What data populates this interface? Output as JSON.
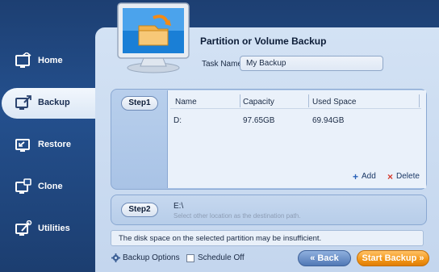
{
  "sidebar": {
    "items": [
      {
        "label": "Home",
        "icon": "home-icon"
      },
      {
        "label": "Backup",
        "icon": "backup-icon",
        "active": true
      },
      {
        "label": "Restore",
        "icon": "restore-icon"
      },
      {
        "label": "Clone",
        "icon": "clone-icon"
      },
      {
        "label": "Utilities",
        "icon": "utilities-icon"
      }
    ]
  },
  "header": {
    "title": "Partition or Volume Backup",
    "task_name_label": "Task Name",
    "task_name_value": "My Backup"
  },
  "step1": {
    "label": "Step1",
    "columns": [
      "Name",
      "Capacity",
      "Used Space"
    ],
    "rows": [
      {
        "name": "D:",
        "capacity": "97.65GB",
        "used": "69.94GB"
      }
    ],
    "add_label": "Add",
    "delete_label": "Delete"
  },
  "step2": {
    "label": "Step2",
    "destination": "E:\\",
    "hint": "Select other location as the destination path."
  },
  "warning": "The disk space on the selected partition may be insufficient.",
  "options": {
    "backup_options_label": "Backup Options",
    "schedule_label": "Schedule Off"
  },
  "buttons": {
    "back_label": "« Back",
    "start_label": "Start Backup »"
  },
  "colors": {
    "accent_orange": "#f29618",
    "sidebar_blue": "#24508e",
    "panel_blue": "#d3e2f4"
  }
}
